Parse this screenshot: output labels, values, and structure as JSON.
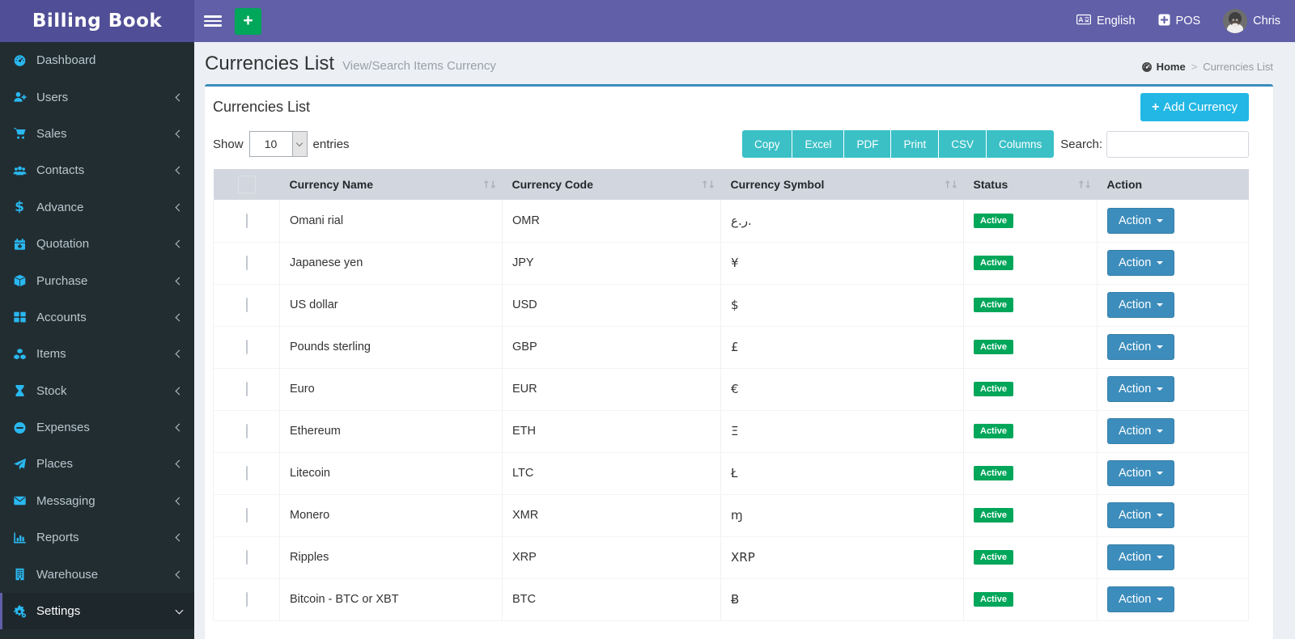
{
  "app": {
    "title": "Billing Book"
  },
  "topbar": {
    "language_label": "English",
    "pos_label": "POS",
    "user_name": "Chris",
    "language_icon": "language-icon",
    "pos_icon": "plus-square-icon",
    "user_icon": "avatar"
  },
  "sidebar": {
    "items": [
      {
        "label": "Dashboard",
        "icon": "dashboard",
        "chevron": "none",
        "active": false
      },
      {
        "label": "Users",
        "icon": "user-plus",
        "chevron": "left",
        "active": false
      },
      {
        "label": "Sales",
        "icon": "cart",
        "chevron": "left",
        "active": false
      },
      {
        "label": "Contacts",
        "icon": "users",
        "chevron": "left",
        "active": false
      },
      {
        "label": "Advance",
        "icon": "dollar",
        "chevron": "left",
        "active": false
      },
      {
        "label": "Quotation",
        "icon": "calendar-plus",
        "chevron": "left",
        "active": false
      },
      {
        "label": "Purchase",
        "icon": "cube",
        "chevron": "left",
        "active": false
      },
      {
        "label": "Accounts",
        "icon": "grid",
        "chevron": "left",
        "active": false
      },
      {
        "label": "Items",
        "icon": "cubes",
        "chevron": "left",
        "active": false
      },
      {
        "label": "Stock",
        "icon": "hourglass",
        "chevron": "left",
        "active": false
      },
      {
        "label": "Expenses",
        "icon": "minus-circle",
        "chevron": "left",
        "active": false
      },
      {
        "label": "Places",
        "icon": "paper-plane",
        "chevron": "left",
        "active": false
      },
      {
        "label": "Messaging",
        "icon": "envelope",
        "chevron": "left",
        "active": false
      },
      {
        "label": "Reports",
        "icon": "bar-chart",
        "chevron": "left",
        "active": false
      },
      {
        "label": "Warehouse",
        "icon": "building",
        "chevron": "left",
        "active": false
      },
      {
        "label": "Settings",
        "icon": "cogs",
        "chevron": "down",
        "active": true
      }
    ]
  },
  "page": {
    "title": "Currencies List",
    "subtitle": "View/Search Items Currency",
    "breadcrumb": {
      "home_label": "Home",
      "separator": ">",
      "current": "Currencies List"
    }
  },
  "panel": {
    "title": "Currencies List",
    "add_button_label": "Add Currency"
  },
  "toolbar": {
    "show_label": "Show",
    "page_length_value": "10",
    "entries_label": "entries",
    "export_buttons": [
      "Copy",
      "Excel",
      "PDF",
      "Print",
      "CSV",
      "Columns"
    ],
    "search_label": "Search:",
    "search_value": ""
  },
  "table": {
    "columns": [
      {
        "label": "Currency Name",
        "sortable": true
      },
      {
        "label": "Currency Code",
        "sortable": true
      },
      {
        "label": "Currency Symbol",
        "sortable": true
      },
      {
        "label": "Status",
        "sortable": true
      },
      {
        "label": "Action",
        "sortable": false
      }
    ],
    "rows": [
      {
        "name": "Omani rial",
        "code": "OMR",
        "symbol": "ر.ع.",
        "status": "Active",
        "action": "Action"
      },
      {
        "name": "Japanese yen",
        "code": "JPY",
        "symbol": "¥",
        "status": "Active",
        "action": "Action"
      },
      {
        "name": "US dollar",
        "code": "USD",
        "symbol": "$",
        "status": "Active",
        "action": "Action"
      },
      {
        "name": "Pounds sterling",
        "code": "GBP",
        "symbol": "£",
        "status": "Active",
        "action": "Action"
      },
      {
        "name": "Euro",
        "code": "EUR",
        "symbol": "€",
        "status": "Active",
        "action": "Action"
      },
      {
        "name": "Ethereum",
        "code": "ETH",
        "symbol": "Ξ",
        "status": "Active",
        "action": "Action"
      },
      {
        "name": "Litecoin",
        "code": "LTC",
        "symbol": "Ł",
        "status": "Active",
        "action": "Action"
      },
      {
        "name": "Monero",
        "code": "XMR",
        "symbol": "ɱ",
        "status": "Active",
        "action": "Action"
      },
      {
        "name": "Ripples",
        "code": "XRP",
        "symbol": "XRP",
        "status": "Active",
        "action": "Action"
      },
      {
        "name": "Bitcoin - BTC or XBT",
        "code": "BTC",
        "symbol": "Ƀ",
        "status": "Active",
        "action": "Action"
      }
    ]
  },
  "colors": {
    "purple": "#605fa8",
    "purple-dark": "#504e96",
    "icon-cyan": "#29b8f0",
    "green": "#00a65a",
    "blue": "#3c8dbc",
    "add-blue": "#23b7e5",
    "teal": "#3bc0c6",
    "th-gray": "#d2d6de"
  }
}
